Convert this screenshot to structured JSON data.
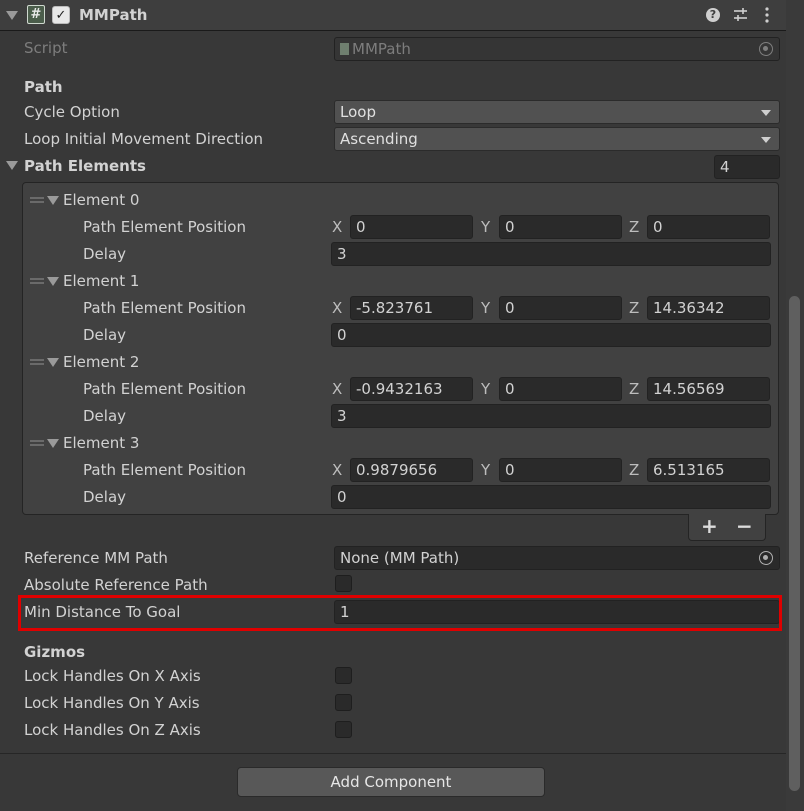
{
  "header": {
    "title": "MMPath",
    "enabled": true
  },
  "script_row": {
    "label": "Script",
    "value": "MMPath"
  },
  "path_section": {
    "heading": "Path",
    "cycle_option": {
      "label": "Cycle Option",
      "value": "Loop"
    },
    "loop_direction": {
      "label": "Loop Initial Movement Direction",
      "value": "Ascending"
    }
  },
  "path_elements": {
    "label": "Path Elements",
    "count": "4",
    "items": [
      {
        "name": "Element 0",
        "pos_label": "Path Element Position",
        "x": "0",
        "y": "0",
        "z": "0",
        "delay_label": "Delay",
        "delay": "3"
      },
      {
        "name": "Element 1",
        "pos_label": "Path Element Position",
        "x": "-5.823761",
        "y": "0",
        "z": "14.36342",
        "delay_label": "Delay",
        "delay": "0"
      },
      {
        "name": "Element 2",
        "pos_label": "Path Element Position",
        "x": "-0.9432163",
        "y": "0",
        "z": "14.56569",
        "delay_label": "Delay",
        "delay": "3"
      },
      {
        "name": "Element 3",
        "pos_label": "Path Element Position",
        "x": "0.9879656",
        "y": "0",
        "z": "6.513165",
        "delay_label": "Delay",
        "delay": "0"
      }
    ],
    "axis_labels": {
      "x": "X",
      "y": "Y",
      "z": "Z"
    },
    "add_label": "+",
    "remove_label": "−"
  },
  "reference": {
    "ref_path": {
      "label": "Reference MM Path",
      "value": "None (MM Path)"
    },
    "absolute": {
      "label": "Absolute Reference Path",
      "checked": false
    },
    "min_distance": {
      "label": "Min Distance To Goal",
      "value": "1"
    }
  },
  "gizmos": {
    "heading": "Gizmos",
    "lock_x": {
      "label": "Lock Handles On X Axis",
      "checked": false
    },
    "lock_y": {
      "label": "Lock Handles On Y Axis",
      "checked": false
    },
    "lock_z": {
      "label": "Lock Handles On Z Axis",
      "checked": false
    }
  },
  "add_component": "Add Component",
  "icons": {
    "script_icon": "hash-script-icon",
    "help": "help-icon",
    "presets": "presets-icon",
    "menu": "kebab-menu-icon",
    "object_picker": "object-picker-icon"
  }
}
